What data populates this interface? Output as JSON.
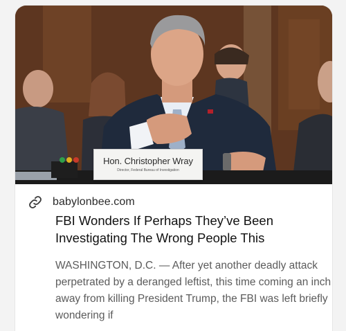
{
  "card": {
    "image": {
      "nameplate_name": "Hon. Christopher Wray",
      "nameplate_subtitle": "Director, Federal Bureau of Investigation"
    },
    "domain": "babylonbee.com",
    "link_icon": "link-icon",
    "headline": "FBI Wonders If Perhaps They’ve Been Investigating The Wrong People This",
    "excerpt": "WASHINGTON, D.C. — After yet another deadly attack perpetrated by a deranged leftist, this time coming an inch away from killing President Trump, the FBI was left briefly wondering if"
  },
  "colors": {
    "background": "#f3f3f3",
    "card": "#ffffff",
    "headline": "#111111",
    "excerpt": "#5b5b5b"
  }
}
